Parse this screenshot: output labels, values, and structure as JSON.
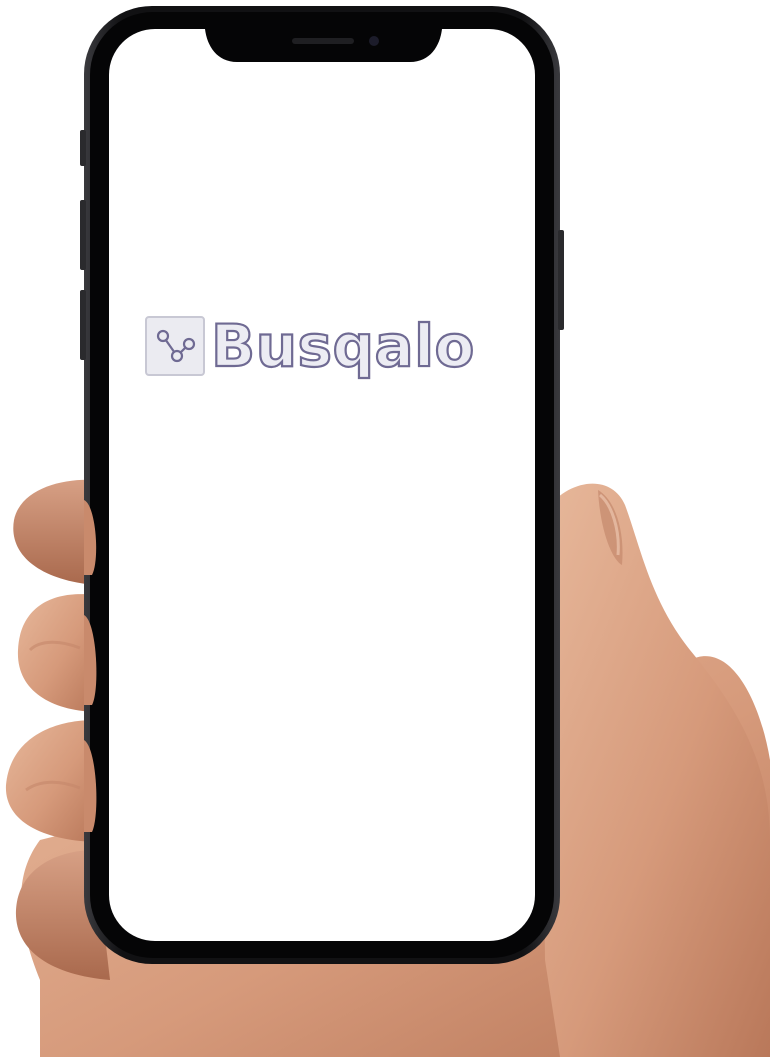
{
  "app": {
    "brand_name": "Busqalo",
    "logo_icon": "share-nodes-icon"
  },
  "colors": {
    "logo_outline": "#6f6a93",
    "logo_fill": "#ececf3",
    "screen": "#ffffff",
    "phone_frame": "#1a1a1c"
  }
}
